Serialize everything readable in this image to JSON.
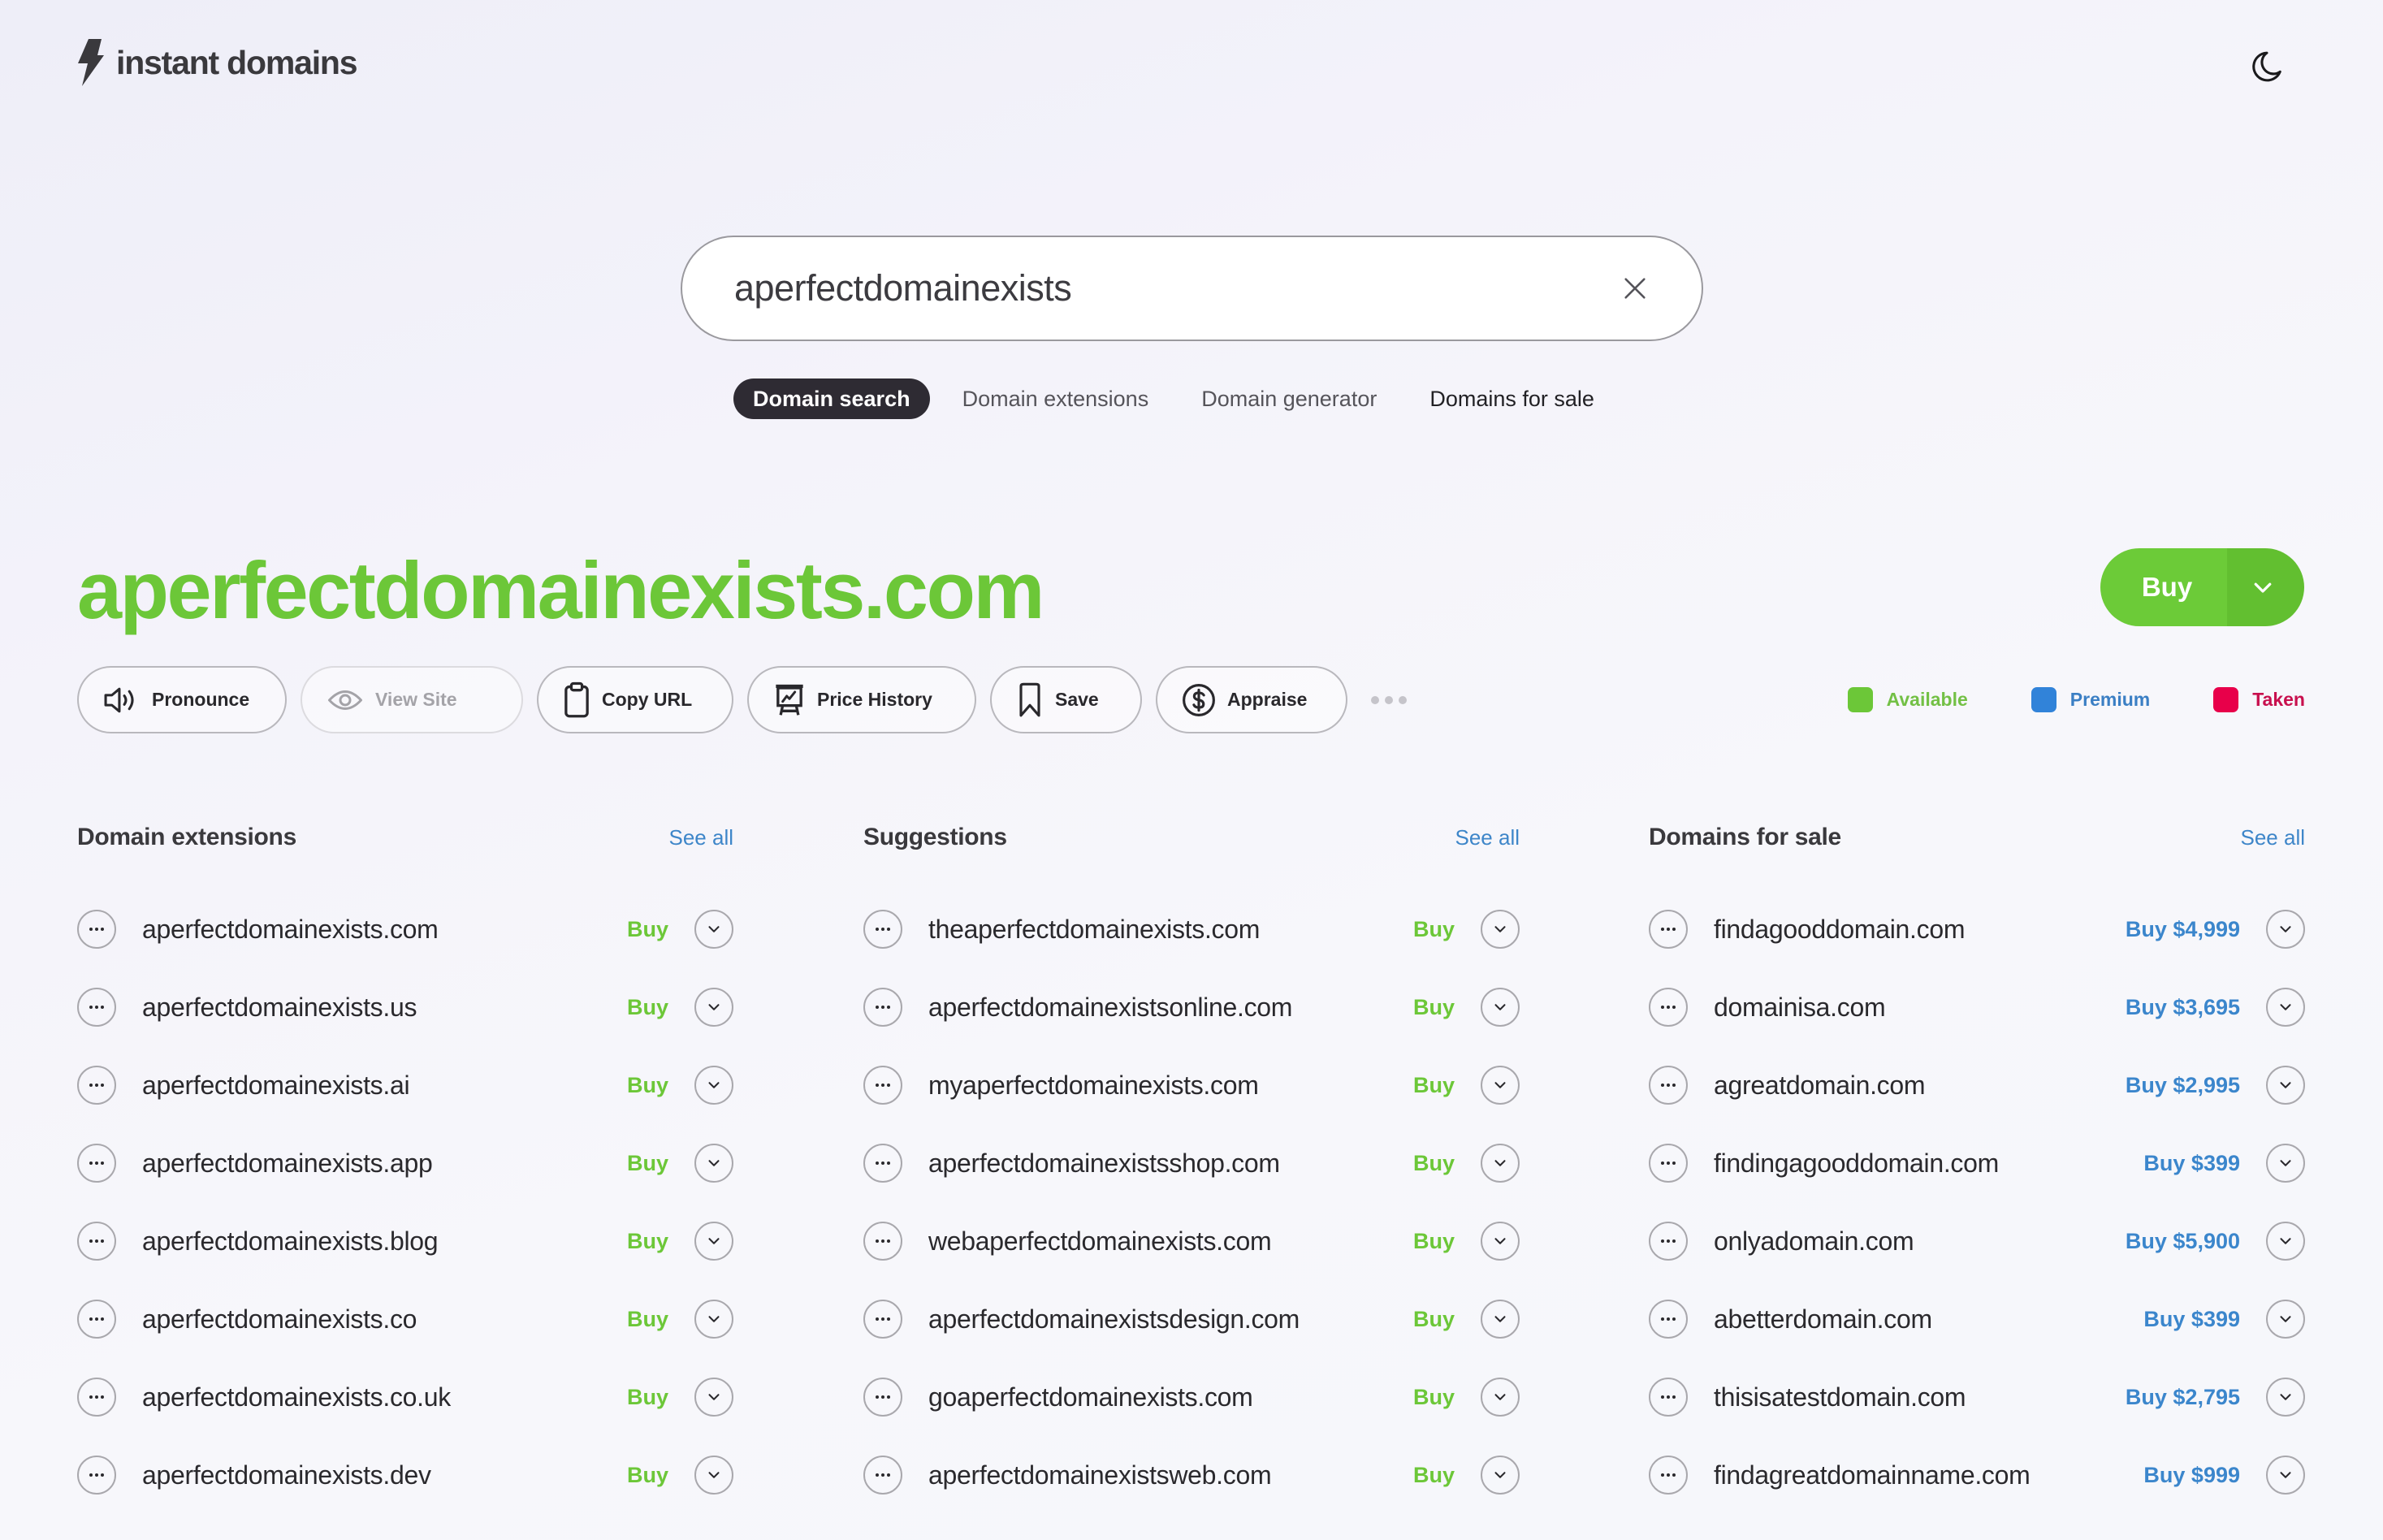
{
  "header": {
    "logo_text": "instant domains",
    "theme_toggle_icon": "moon-icon"
  },
  "search": {
    "value": "aperfectdomainexists",
    "placeholder": ""
  },
  "tabs": [
    {
      "label": "Domain search",
      "active": true
    },
    {
      "label": "Domain extensions",
      "active": false
    },
    {
      "label": "Domain generator",
      "active": false
    },
    {
      "label": "Domains for sale",
      "active": false
    }
  ],
  "result": {
    "domain": "aperfectdomainexists.com",
    "buy_label": "Buy",
    "status": "available"
  },
  "actions": [
    {
      "label": "Pronounce",
      "icon": "speaker-icon",
      "enabled": true
    },
    {
      "label": "View Site",
      "icon": "eye-icon",
      "enabled": false
    },
    {
      "label": "Copy URL",
      "icon": "clipboard-icon",
      "enabled": true
    },
    {
      "label": "Price History",
      "icon": "chart-board-icon",
      "enabled": true
    },
    {
      "label": "Save",
      "icon": "bookmark-icon",
      "enabled": true
    },
    {
      "label": "Appraise",
      "icon": "dollar-circle-icon",
      "enabled": true
    }
  ],
  "legend": [
    {
      "label": "Available",
      "color": "#6cc738",
      "text_color": "#73c045"
    },
    {
      "label": "Premium",
      "color": "#3183d9",
      "text_color": "#3b7fc4"
    },
    {
      "label": "Taken",
      "color": "#e8004a",
      "text_color": "#c8104e"
    }
  ],
  "colors": {
    "available": "#6cc738",
    "premium": "#3b86cc",
    "taken": "#e8004a",
    "link": "#3e86c9"
  },
  "sections": {
    "extensions": {
      "title": "Domain extensions",
      "see_all": "See all",
      "items": [
        {
          "name": "aperfectdomainexists.com",
          "buy": "Buy"
        },
        {
          "name": "aperfectdomainexists.us",
          "buy": "Buy"
        },
        {
          "name": "aperfectdomainexists.ai",
          "buy": "Buy"
        },
        {
          "name": "aperfectdomainexists.app",
          "buy": "Buy"
        },
        {
          "name": "aperfectdomainexists.blog",
          "buy": "Buy"
        },
        {
          "name": "aperfectdomainexists.co",
          "buy": "Buy"
        },
        {
          "name": "aperfectdomainexists.co.uk",
          "buy": "Buy"
        },
        {
          "name": "aperfectdomainexists.dev",
          "buy": "Buy"
        }
      ]
    },
    "suggestions": {
      "title": "Suggestions",
      "see_all": "See all",
      "items": [
        {
          "name": "theaperfectdomainexists.com",
          "buy": "Buy"
        },
        {
          "name": "aperfectdomainexistsonline.com",
          "buy": "Buy"
        },
        {
          "name": "myaperfectdomainexists.com",
          "buy": "Buy"
        },
        {
          "name": "aperfectdomainexistsshop.com",
          "buy": "Buy"
        },
        {
          "name": "webaperfectdomainexists.com",
          "buy": "Buy"
        },
        {
          "name": "aperfectdomainexistsdesign.com",
          "buy": "Buy"
        },
        {
          "name": "goaperfectdomainexists.com",
          "buy": "Buy"
        },
        {
          "name": "aperfectdomainexistsweb.com",
          "buy": "Buy"
        }
      ]
    },
    "for_sale": {
      "title": "Domains for sale",
      "see_all": "See all",
      "items": [
        {
          "name": "findagooddomain.com",
          "buy": "Buy $4,999"
        },
        {
          "name": "domainisa.com",
          "buy": "Buy $3,695"
        },
        {
          "name": "agreatdomain.com",
          "buy": "Buy $2,995"
        },
        {
          "name": "findingagooddomain.com",
          "buy": "Buy $399"
        },
        {
          "name": "onlyadomain.com",
          "buy": "Buy $5,900"
        },
        {
          "name": "abetterdomain.com",
          "buy": "Buy $399"
        },
        {
          "name": "thisisatestdomain.com",
          "buy": "Buy $2,795"
        },
        {
          "name": "findagreatdomainname.com",
          "buy": "Buy $999"
        }
      ]
    }
  }
}
